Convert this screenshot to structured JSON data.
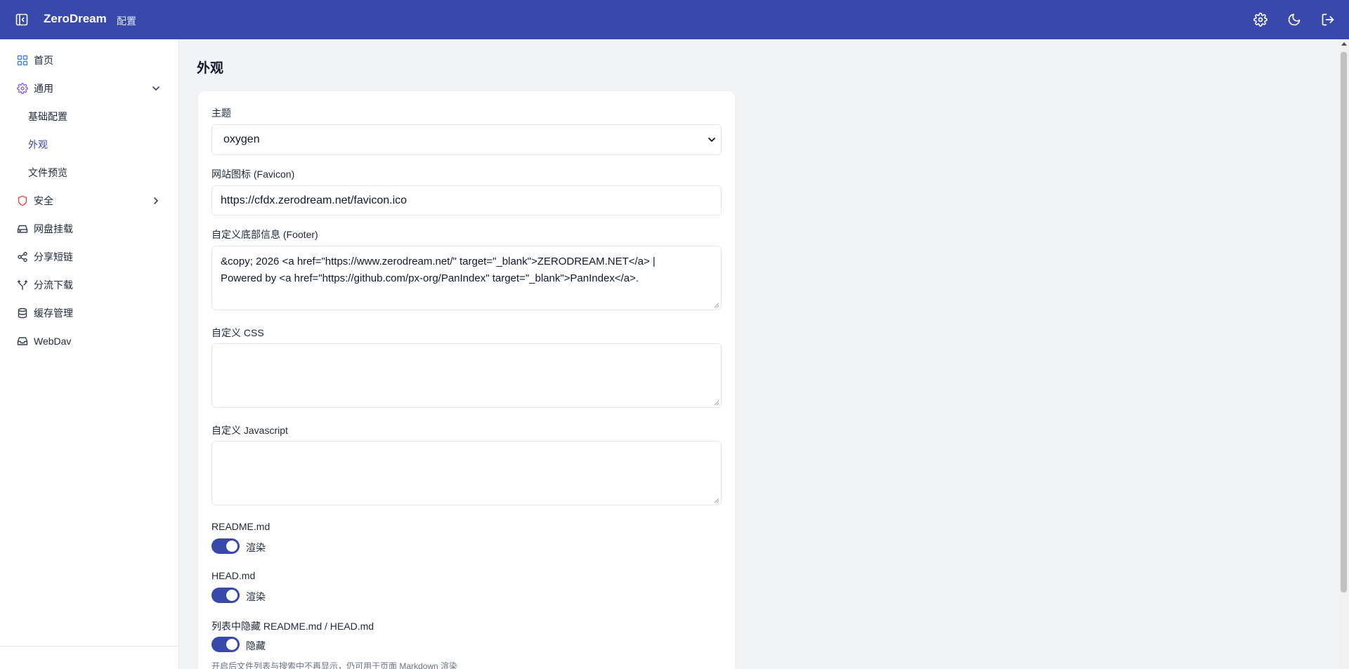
{
  "header": {
    "brand": "ZeroDream",
    "subtitle": "配置",
    "icons": [
      "sidebar-collapse-icon",
      "gear-icon",
      "moon-icon",
      "logout-icon"
    ]
  },
  "sidebar": {
    "items": [
      {
        "label": "首页",
        "icon": "grid-icon",
        "color": "#3b82f6"
      },
      {
        "label": "通用",
        "icon": "gear-icon",
        "color": "#8b5cf6",
        "expanded": true
      },
      {
        "label": "安全",
        "icon": "shield-icon",
        "color": "#ef4444"
      },
      {
        "label": "网盘挂载",
        "icon": "drive-icon",
        "color": "#374151"
      },
      {
        "label": "分享短链",
        "icon": "share-icon",
        "color": "#374151"
      },
      {
        "label": "分流下载",
        "icon": "split-icon",
        "color": "#374151"
      },
      {
        "label": "缓存管理",
        "icon": "database-icon",
        "color": "#374151"
      },
      {
        "label": "WebDav",
        "icon": "inbox-icon",
        "color": "#374151"
      }
    ],
    "sub_items": [
      {
        "label": "基础配置"
      },
      {
        "label": "外观",
        "active": true
      },
      {
        "label": "文件预览"
      }
    ]
  },
  "main": {
    "title": "外观",
    "theme": {
      "label": "主题",
      "value": "oxygen"
    },
    "favicon": {
      "label": "网站图标 (Favicon)",
      "value": "https://cfdx.zerodream.net/favicon.ico"
    },
    "footer": {
      "label": "自定义底部信息 (Footer)",
      "line1": "&copy; 2026 <a href=\"https://www.zerodream.net/\" target=\"_blank\">ZERODREAM.NET</a> |",
      "line2": "Powered by <a href=\"https://github.com/px-org/PanIndex\" target=\"_blank\">PanIndex</a>."
    },
    "css": {
      "label": "自定义 CSS",
      "value": ""
    },
    "js": {
      "label": "自定义 Javascript",
      "value": ""
    },
    "readme": {
      "label": "README.md",
      "toggle_label": "渲染",
      "on": true
    },
    "head": {
      "label": "HEAD.md",
      "toggle_label": "渲染",
      "on": true
    },
    "hide": {
      "label": "列表中隐藏 README.md / HEAD.md",
      "toggle_label": "隐藏",
      "on": true
    },
    "hint": "开启后文件列表与搜索中不再显示，仍可用于页面 Markdown 渲染"
  },
  "colors": {
    "accent": "#3949ab",
    "background": "#f3f4f6"
  }
}
